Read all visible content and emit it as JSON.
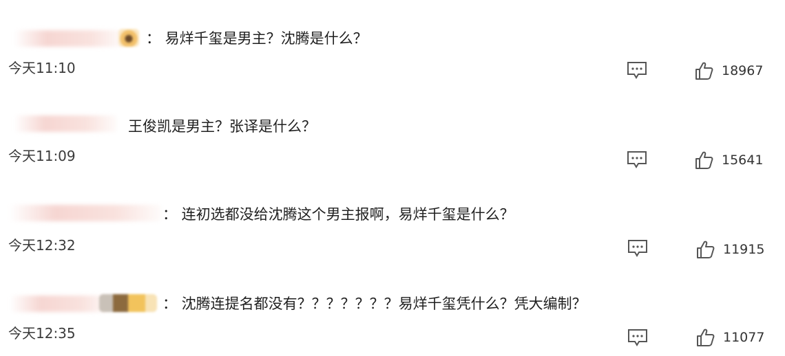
{
  "comments": [
    {
      "text": "：  易烊千玺是男主？沈腾是什么？",
      "time": "今天11:10",
      "likes": "18967",
      "reply_icon": "comment-icon",
      "like_icon": "thumbs-up-icon"
    },
    {
      "text": "王俊凯是男主？张译是什么？",
      "time": "今天11:09",
      "likes": "15641",
      "reply_icon": "comment-icon",
      "like_icon": "thumbs-up-icon"
    },
    {
      "text": "：  连初选都没给沈腾这个男主报啊，易烊千玺是什么？",
      "time": "今天12:32",
      "likes": "11915",
      "reply_icon": "comment-icon",
      "like_icon": "thumbs-up-icon"
    },
    {
      "text": "：  沈腾连提名都没有？？？？？？？易烊千玺凭什么？凭大编制？",
      "time": "今天12:35",
      "likes": "11077",
      "reply_icon": "comment-icon",
      "like_icon": "thumbs-up-icon"
    }
  ],
  "colors": {
    "text": "#1f1f1f",
    "meta": "#3a3a3a",
    "icon": "#555555",
    "username_blur": "#f6d6d2"
  }
}
